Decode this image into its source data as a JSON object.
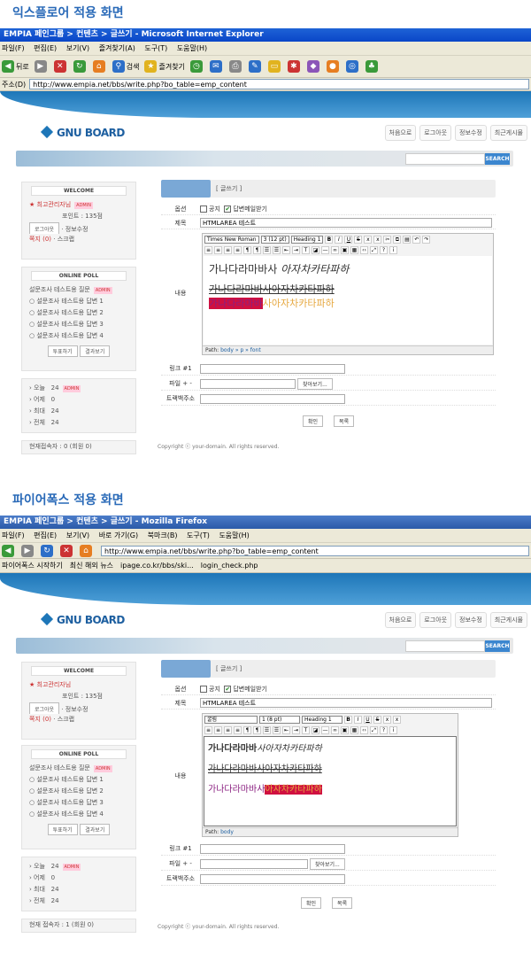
{
  "ie": {
    "heading": "익스플로어 적용 화면",
    "window_title": "EMPIA 페인그룹 > 컨텐츠 > 글쓰기 - Microsoft Internet Explorer",
    "menu": [
      "파일(F)",
      "편집(E)",
      "보기(V)",
      "즐겨찾기(A)",
      "도구(T)",
      "도움말(H)"
    ],
    "toolbar": {
      "back": "뒤로",
      "search": "검색",
      "favorites": "즐겨찾기"
    },
    "address_label": "주소(D)",
    "address": "http://www.empia.net/bbs/write.php?bo_table=emp_content",
    "editor": {
      "font": "Times New Roman",
      "size": "3 (12 pt)",
      "format": "Heading 1",
      "line1_a": "가나다라마바사 ",
      "line1_b": "아자차카타파하",
      "line2": "가나다라마바사아자차카타파하",
      "line3_a": "가나다라마바",
      "line3_b": "사아자차카타파하",
      "path_label": "Path:",
      "path": "body » p » font"
    }
  },
  "ff": {
    "heading": "파이어폭스 적용 화면",
    "window_title": "EMPIA 페인그룹 > 컨텐츠 > 글쓰기 - Mozilla Firefox",
    "menu": [
      "파일(F)",
      "편집(E)",
      "보기(V)",
      "바로 가기(G)",
      "북마크(B)",
      "도구(T)",
      "도움말(H)"
    ],
    "address": "http://www.empia.net/bbs/write.php?bo_table=emp_content",
    "bookmarks": [
      "파이어폭스 시작하기",
      "최신 해외 뉴스",
      "ipage.co.kr/bbs/ski...",
      "login_check.php"
    ],
    "editor": {
      "font": "굴림",
      "size": "1 (8 pt)",
      "format": "Heading 1",
      "line1_a": "가나다라마바",
      "line1_b": "사아자차카타파하",
      "line2": "가나다라마바사아자차카타파하",
      "line3_a": "가나다라마바사",
      "line3_b": "아자차카타파하",
      "path_label": "Path:",
      "path": "body"
    }
  },
  "site": {
    "logo": "GNU BOARD",
    "nav": [
      "처음으로",
      "로그아웃",
      "정보수정",
      "최근게시물"
    ],
    "search_btn": "SEARCH",
    "welcome": "WELCOME",
    "user": "최고관리자님",
    "admin": "ADMIN",
    "point": "포인트 : 135점",
    "logout": "로그아웃",
    "info_edit": "정보수정",
    "memo": "쪽지 (0)",
    "scrap": "스크랩",
    "poll_head": "ONLINE POLL",
    "poll_q": "설문조사 테스트용 질문",
    "poll_opts": [
      "설문조사 테스트용 답변 1",
      "설문조사 테스트용 답변 2",
      "설문조사 테스트용 답변 3",
      "설문조사 테스트용 답변 4"
    ],
    "vote": "투표하기",
    "result": "결과보기",
    "visit": [
      {
        "label": "오늘",
        "value": "24"
      },
      {
        "label": "어제",
        "value": "0"
      },
      {
        "label": "최대",
        "value": "24"
      },
      {
        "label": "전체",
        "value": "24"
      }
    ],
    "tab_title": "[ 글쓰기 ]",
    "opt_label": "옵션",
    "opt_notice": "공지",
    "opt_mail": "답변메일받기",
    "subject_label": "제목",
    "subject": "HTMLAREA 테스트",
    "content_label": "내용",
    "link_label": "링크 #1",
    "file_label": "파일 + -",
    "browse": "찾아보기...",
    "trackback_label": "트랙백주소",
    "ok": "확인",
    "list": "목록",
    "copyright": "Copyright ⓒ your-domain. All rights reserved."
  },
  "ie_online": "현재접속자 : 0 (회원 0)",
  "ff_online": "현재 접속자 : 1 (회원 0)"
}
